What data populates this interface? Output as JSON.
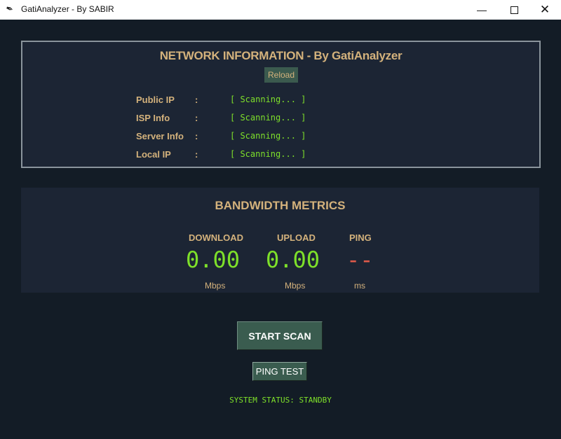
{
  "window": {
    "title": "GatiAnalyzer - By SABIR",
    "app_icon": "feather-icon"
  },
  "network": {
    "title": "NETWORK INFORMATION - By GatiAnalyzer",
    "reload_label": "Reload",
    "rows": [
      {
        "label": "Public IP",
        "colon": ":",
        "value": "[ Scanning... ]"
      },
      {
        "label": "ISP Info",
        "colon": ":",
        "value": "[ Scanning... ]"
      },
      {
        "label": "Server Info",
        "colon": ":",
        "value": "[ Scanning... ]"
      },
      {
        "label": "Local IP",
        "colon": ":",
        "value": "[ Scanning... ]"
      }
    ]
  },
  "bandwidth": {
    "title": "BANDWIDTH METRICS",
    "download": {
      "label": "DOWNLOAD",
      "value": "0.00",
      "unit": "Mbps"
    },
    "upload": {
      "label": "UPLOAD",
      "value": "0.00",
      "unit": "Mbps"
    },
    "ping": {
      "label": "PING",
      "value": "--",
      "unit": "ms"
    }
  },
  "actions": {
    "start_label": "START SCAN",
    "ping_label": "PING TEST"
  },
  "status": "SYSTEM STATUS: STANDBY",
  "colors": {
    "accent": "#d4b27c",
    "value_green": "#7ee02a",
    "ping_red": "#e05a4a",
    "button": "#3a5c4f",
    "panel": "#1c2534",
    "background": "#131c26"
  }
}
